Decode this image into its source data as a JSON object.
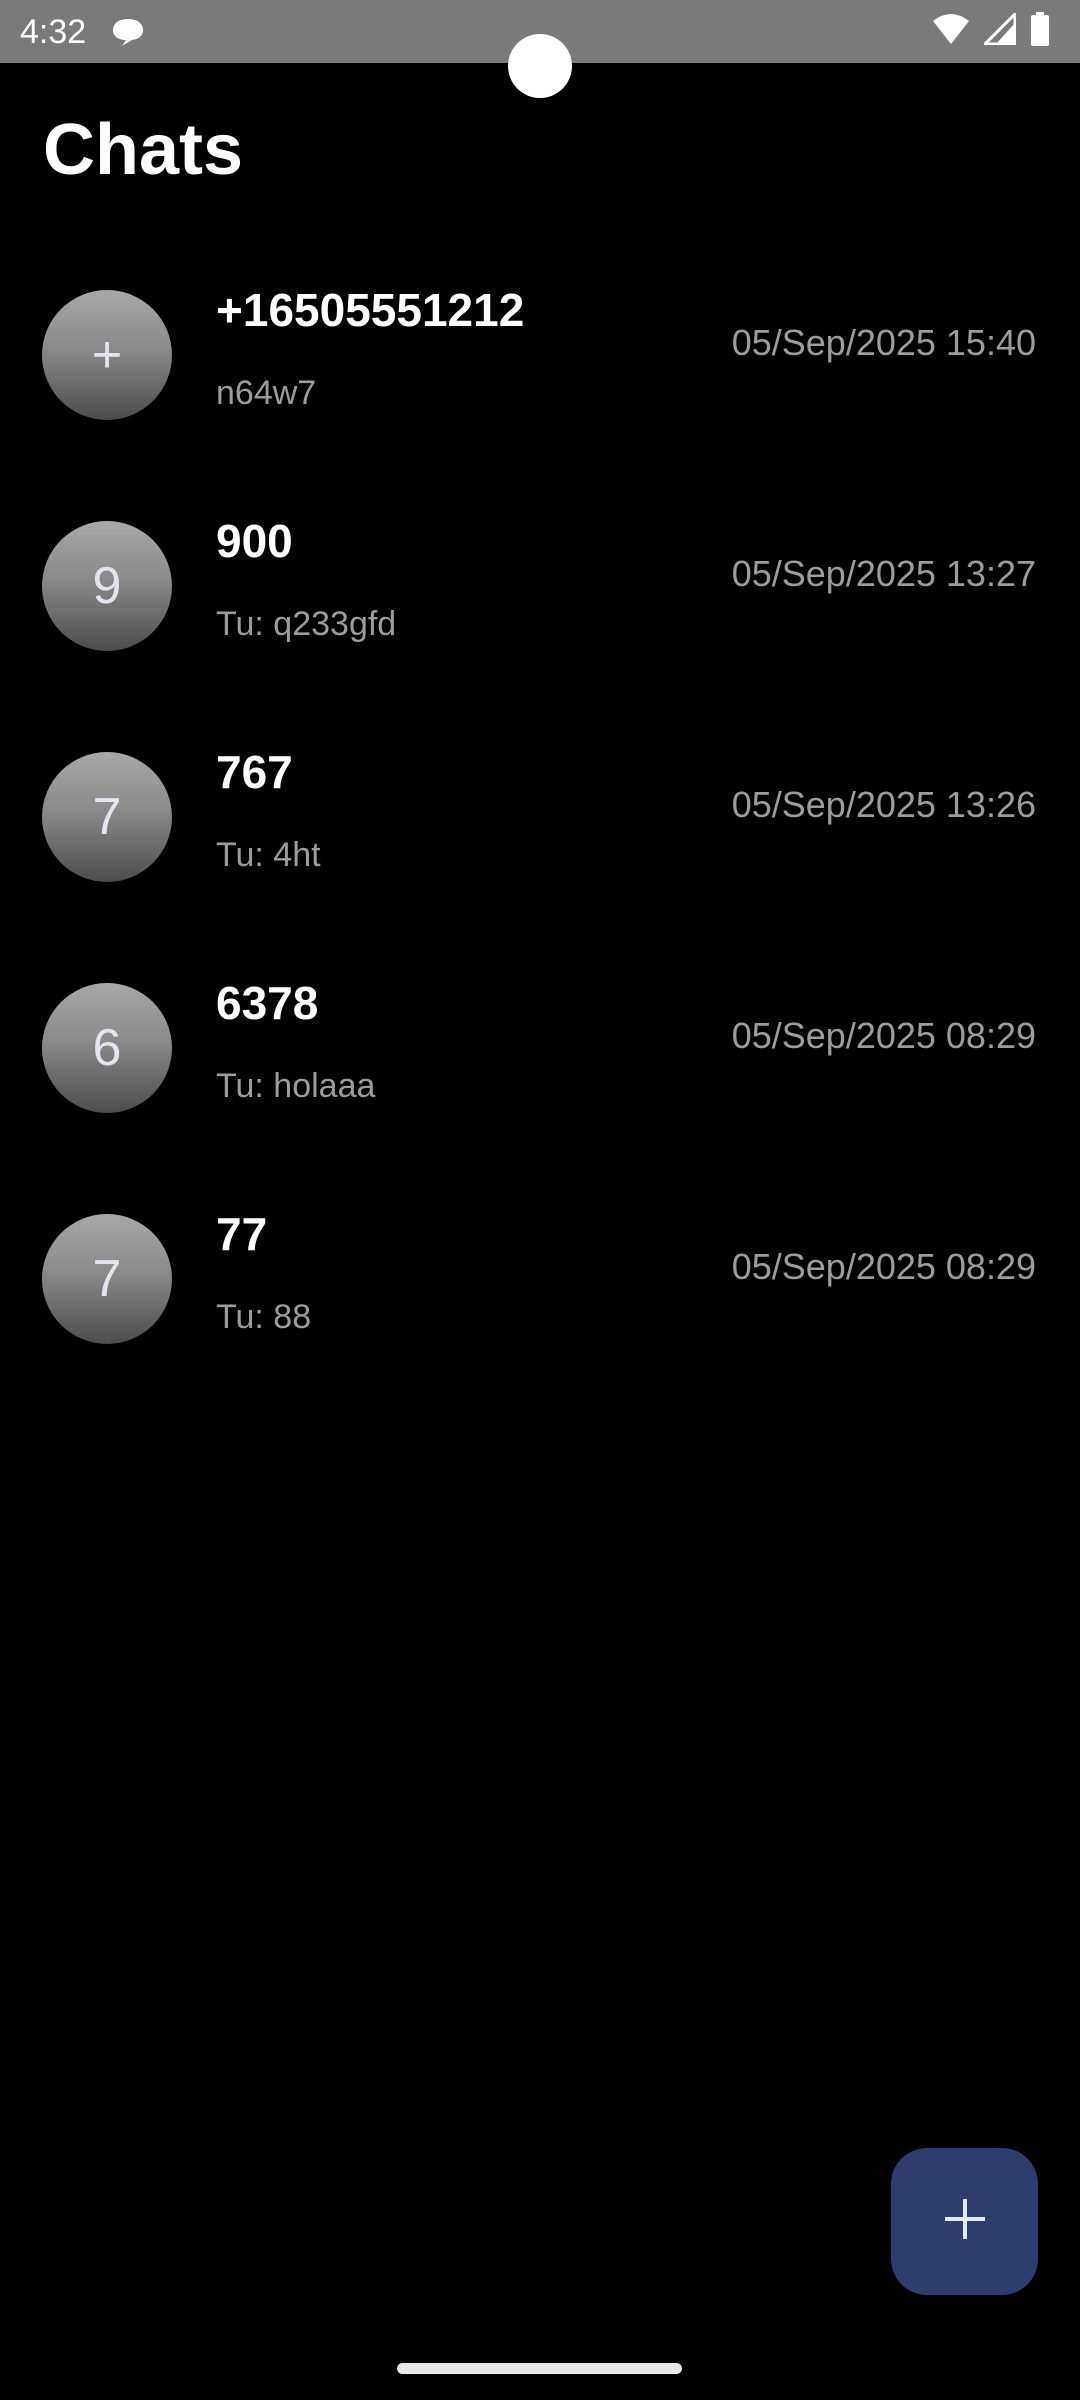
{
  "status_bar": {
    "time": "4:32",
    "left_icons": [
      "chat-bubble-icon"
    ],
    "right_icons": [
      "wifi-icon",
      "cell-signal-icon",
      "battery-icon"
    ]
  },
  "header": {
    "title": "Chats"
  },
  "chats": [
    {
      "avatar_letter": "+",
      "name": "+16505551212",
      "preview": "n64w7",
      "time": "05/Sep/2025 15:40"
    },
    {
      "avatar_letter": "9",
      "name": "900",
      "preview": "Tu: q233gfd",
      "time": "05/Sep/2025 13:27"
    },
    {
      "avatar_letter": "7",
      "name": "767",
      "preview": "Tu: 4ht",
      "time": "05/Sep/2025 13:26"
    },
    {
      "avatar_letter": "6",
      "name": "6378",
      "preview": "Tu: holaaa",
      "time": "05/Sep/2025 08:29"
    },
    {
      "avatar_letter": "7",
      "name": "77",
      "preview": "Tu: 88",
      "time": "05/Sep/2025 08:29"
    }
  ],
  "fab": {
    "icon": "plus-icon"
  },
  "colors": {
    "background": "#000000",
    "status_bar": "#7a7a7a",
    "fab": "#2e3d6e",
    "secondary_text": "#9c9c9c"
  }
}
